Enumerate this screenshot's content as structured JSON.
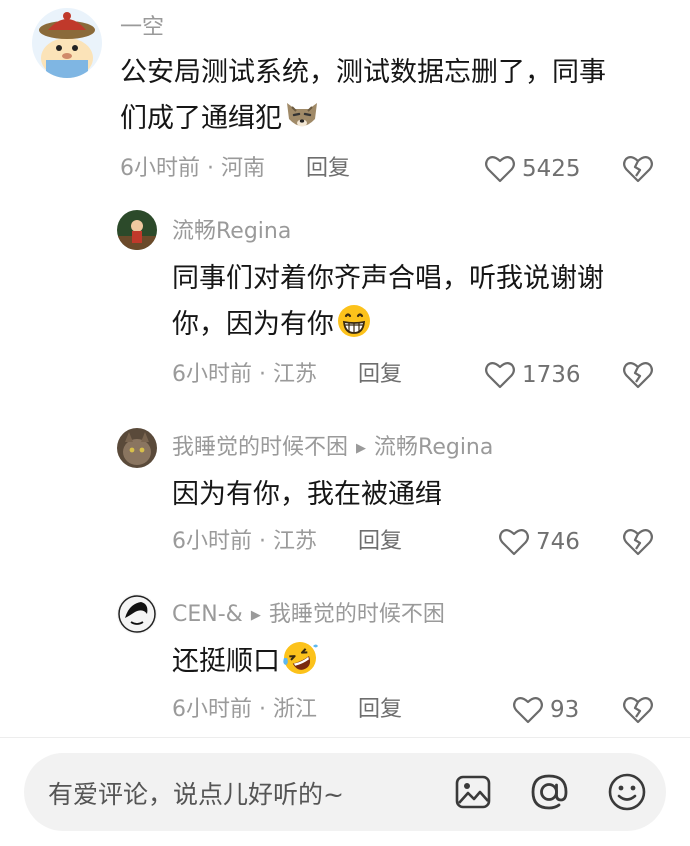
{
  "comments": [
    {
      "user": "一空",
      "text": "公安局测试系统，测试数据忘删了，同事们成了通缉犯",
      "text_line1": "公安局测试系统，测试数据忘删了，同事",
      "text_line2": "们成了通缉犯",
      "emoji": "wolf-face-emoji",
      "time": "6小时前",
      "location": "河南",
      "reply_label": "回复",
      "likes": "5425"
    },
    {
      "user": "流畅Regina",
      "text_line1": "同事们对着你齐声合唱，听我说谢谢",
      "text_line2": "你，因为有你",
      "emoji": "grinning-face-emoji",
      "time": "6小时前",
      "location": "江苏",
      "reply_label": "回复",
      "likes": "1736"
    },
    {
      "user": "我睡觉的时候不困",
      "reply_to": "流畅Regina",
      "text": "因为有你，我在被通缉",
      "time": "6小时前",
      "location": "江苏",
      "reply_label": "回复",
      "likes": "746"
    },
    {
      "user": "CEN-&",
      "reply_to": "我睡觉的时候不困",
      "text": "还挺顺口",
      "emoji": "rolling-on-floor-laughing-emoji",
      "time": "6小时前",
      "location": "浙江",
      "reply_label": "回复",
      "likes": "93"
    }
  ],
  "meta_separator": "·",
  "input": {
    "placeholder": "有爱评论，说点儿好听的~"
  },
  "icons": {
    "image": "image-icon",
    "mention": "at-icon",
    "emoji": "smiley-icon",
    "like": "heart-icon",
    "dislike": "broken-heart-icon"
  },
  "colors": {
    "text_primary": "#161616",
    "text_secondary": "#9a9a9a",
    "input_bg": "#f2f2f2"
  }
}
